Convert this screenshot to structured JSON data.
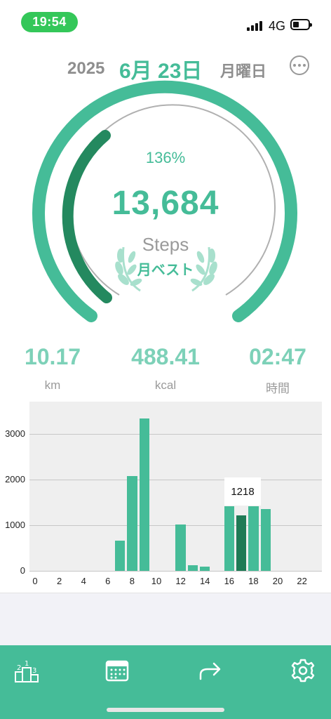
{
  "status": {
    "time": "19:54",
    "network": "4G"
  },
  "date": {
    "year": "2025",
    "month_day": "6月 23日",
    "weekday": "月曜日"
  },
  "gauge": {
    "percent": "136%",
    "steps": "13,684",
    "steps_label": "Steps",
    "badge": "月ベスト",
    "progress_fraction": 1.36
  },
  "metrics": [
    {
      "value": "10.17",
      "unit": "km"
    },
    {
      "value": "488.41",
      "unit": "kcal"
    },
    {
      "value": "02:47",
      "unit": "時間"
    }
  ],
  "chart_data": {
    "type": "bar",
    "x": [
      0,
      1,
      2,
      3,
      4,
      5,
      6,
      7,
      8,
      9,
      10,
      11,
      12,
      13,
      14,
      15,
      16,
      17,
      18,
      19,
      20,
      21,
      22,
      23
    ],
    "values": [
      0,
      0,
      0,
      0,
      0,
      0,
      0,
      660,
      2080,
      3350,
      0,
      0,
      1010,
      130,
      90,
      0,
      1420,
      1218,
      1420,
      1350,
      0,
      0,
      0,
      0
    ],
    "x_tick_labels": [
      "0",
      "2",
      "4",
      "6",
      "8",
      "10",
      "12",
      "14",
      "16",
      "18",
      "20",
      "22"
    ],
    "y_tick_labels": [
      "0",
      "1000",
      "2000",
      "3000"
    ],
    "ylim": [
      0,
      3050
    ],
    "selected_hour": 17,
    "tooltip": "1218",
    "grid": true
  },
  "tabs": [
    {
      "name": "ranking",
      "icon": "podium-icon"
    },
    {
      "name": "calendar",
      "icon": "calendar-icon"
    },
    {
      "name": "share",
      "icon": "share-icon"
    },
    {
      "name": "settings",
      "icon": "gear-icon"
    }
  ],
  "colors": {
    "accent": "#45bc98",
    "accent_dark": "#1f7a55",
    "gauge_dark": "#24895f",
    "status_green": "#34c759"
  }
}
